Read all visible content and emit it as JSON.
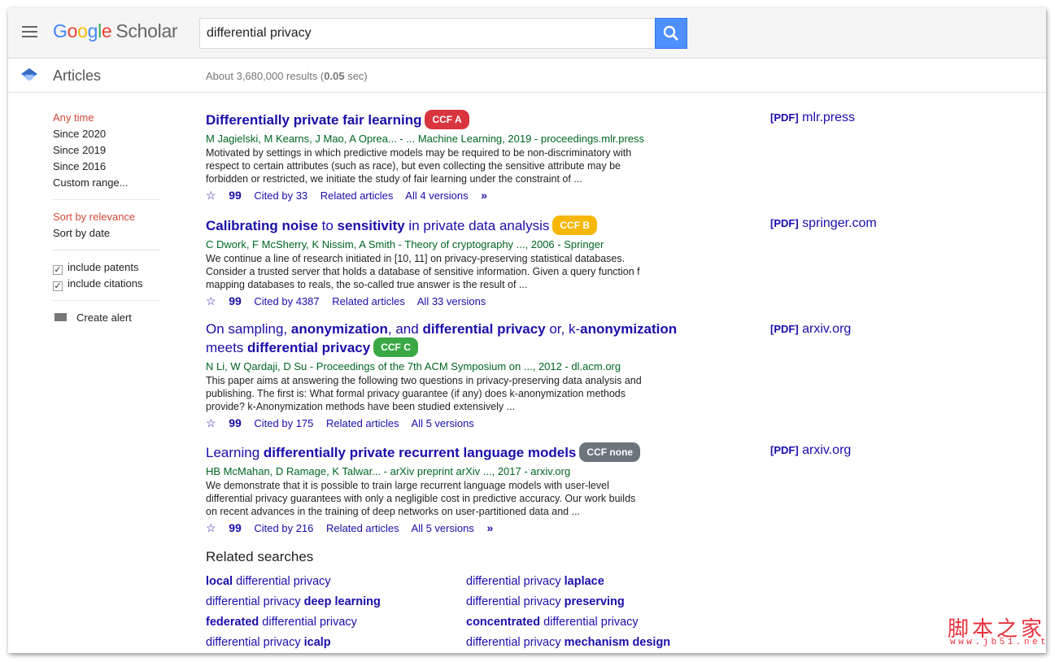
{
  "header": {
    "logo_google": "Google",
    "logo_scholar": "Scholar",
    "query": "differential privacy"
  },
  "subheader": {
    "section": "Articles",
    "results_prefix": "About 3,680,000 results (",
    "results_time": "0.05",
    "results_suffix": " sec)"
  },
  "sidebar": {
    "time": [
      "Any time",
      "Since 2020",
      "Since 2019",
      "Since 2016",
      "Custom range..."
    ],
    "sort": [
      "Sort by relevance",
      "Sort by date"
    ],
    "include_patents": "include patents",
    "include_citations": "include citations",
    "create_alert": "Create alert"
  },
  "results": [
    {
      "title": [
        {
          "t": "Differentially private fair learning",
          "b": true
        }
      ],
      "badge": "CCF A",
      "badge_color": "#d9353f",
      "meta": "M Jagielski, M Kearns, J Mao, A Oprea... - ... Machine Learning, 2019 - proceedings.mlr.press",
      "snippet": "Motivated by settings in which predictive models may be required to be non-discriminatory with respect to certain attributes (such as race), but even collecting the sensitive attribute may be forbidden or restricted, we initiate the study of fair learning under the constraint of ...",
      "cited": "Cited by 33",
      "related": "Related articles",
      "versions": "All 4 versions",
      "pdf_label": "[PDF]",
      "pdf_site": "mlr.press"
    },
    {
      "title": [
        {
          "t": "Calibrating noise",
          "b": true
        },
        {
          "t": " to ",
          "b": false
        },
        {
          "t": "sensitivity",
          "b": true
        },
        {
          "t": " in private data analysis",
          "b": false
        }
      ],
      "badge": "CCF B",
      "badge_color": "#f5b700",
      "meta": "C Dwork, F McSherry, K Nissim, A Smith - Theory of cryptography ..., 2006 - Springer",
      "snippet": "We continue a line of research initiated in [10, 11] on privacy-preserving statistical databases. Consider a trusted server that holds a database of sensitive information. Given a query function f mapping databases to reals, the so-called true answer is the result of ...",
      "cited": "Cited by 4387",
      "related": "Related articles",
      "versions": "All 33 versions",
      "pdf_label": "[PDF]",
      "pdf_site": "springer.com"
    },
    {
      "title": [
        {
          "t": "On sampling, ",
          "b": false
        },
        {
          "t": "anonymization",
          "b": true
        },
        {
          "t": ", and ",
          "b": false
        },
        {
          "t": "differential privacy",
          "b": true
        },
        {
          "t": " or, k-",
          "b": false
        },
        {
          "t": "anonymization",
          "b": true
        },
        {
          "t": " meets ",
          "b": false
        },
        {
          "t": "differential privacy",
          "b": true
        }
      ],
      "badge": "CCF C",
      "badge_color": "#3aa845",
      "meta": "N Li, W Qardaji, D Su - Proceedings of the 7th ACM Symposium on ..., 2012 - dl.acm.org",
      "snippet": "This paper aims at answering the following two questions in privacy-preserving data analysis and publishing. The first is: What formal privacy guarantee (if any) does k-anonymization methods provide? k-Anonymization methods have been studied extensively ...",
      "cited": "Cited by 175",
      "related": "Related articles",
      "versions": "All 5 versions",
      "pdf_label": "[PDF]",
      "pdf_site": "arxiv.org"
    },
    {
      "title": [
        {
          "t": "Learning ",
          "b": false
        },
        {
          "t": "differentially private recurrent language models",
          "b": true
        }
      ],
      "badge": "CCF none",
      "badge_color": "#6c757d",
      "meta": "HB McMahan, D Ramage, K Talwar... - arXiv preprint arXiv ..., 2017 - arxiv.org",
      "snippet": "We demonstrate that it is possible to train large recurrent language models with user-level differential privacy guarantees with only a negligible cost in predictive accuracy. Our work builds on recent advances in the training of deep networks on user-partitioned data and ...",
      "cited": "Cited by 216",
      "related": "Related articles",
      "versions": "All 5 versions",
      "pdf_label": "[PDF]",
      "pdf_site": "arxiv.org"
    }
  ],
  "related": {
    "heading": "Related searches",
    "items": [
      [
        {
          "t": "local",
          "b": true
        },
        {
          "t": " differential privacy",
          "b": false
        }
      ],
      [
        {
          "t": "differential privacy ",
          "b": false
        },
        {
          "t": "laplace",
          "b": true
        }
      ],
      [
        {
          "t": "differential privacy ",
          "b": false
        },
        {
          "t": "deep learning",
          "b": true
        }
      ],
      [
        {
          "t": "differential privacy ",
          "b": false
        },
        {
          "t": "preserving",
          "b": true
        }
      ],
      [
        {
          "t": "federated",
          "b": true
        },
        {
          "t": " differential privacy",
          "b": false
        }
      ],
      [
        {
          "t": "concentrated",
          "b": true
        },
        {
          "t": " differential privacy",
          "b": false
        }
      ],
      [
        {
          "t": "differential privacy ",
          "b": false
        },
        {
          "t": "icalp",
          "b": true
        }
      ],
      [
        {
          "t": "differential privacy ",
          "b": false
        },
        {
          "t": "mechanism design",
          "b": true
        }
      ]
    ]
  },
  "watermark": {
    "cn": "脚本之家",
    "url": "www.jb51.net"
  }
}
